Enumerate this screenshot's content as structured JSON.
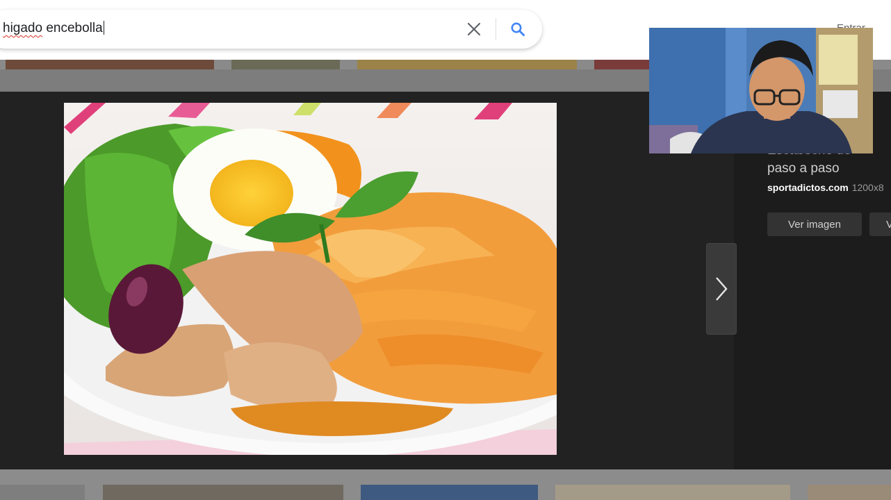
{
  "search": {
    "query_part1": "higado",
    "query_part2": " encebolla"
  },
  "header": {
    "link_label": "Entrar"
  },
  "icons": {
    "clear": "close-icon",
    "search": "search-icon",
    "next": "chevron-right-icon"
  },
  "colors": {
    "search_blue": "#4285f4",
    "dark_panel": "#222222",
    "header_bg": "#ffffff"
  },
  "info_panel": {
    "title_line1": "Escabeche de pescado",
    "title_line2": "paso a paso",
    "source": "sportadictos.com",
    "dimensions": "1200x8",
    "view_button": "Ver imagen",
    "second_button": "V"
  }
}
